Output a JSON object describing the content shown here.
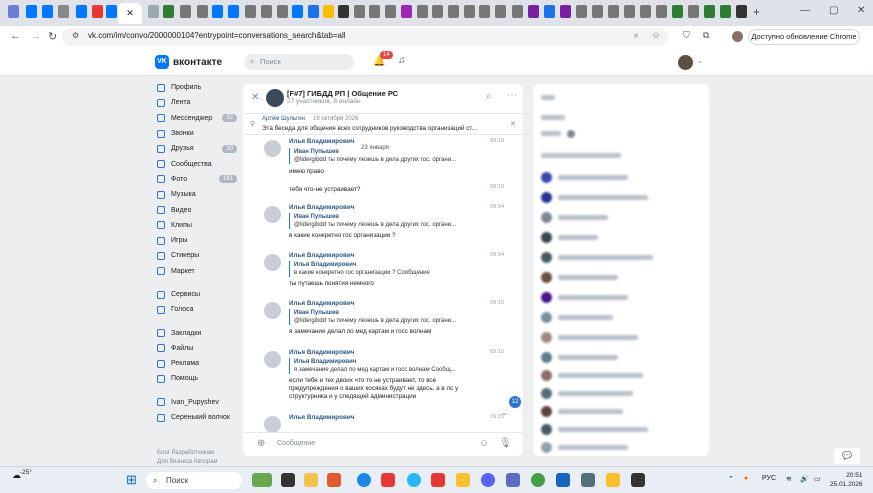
{
  "browser": {
    "url": "vk.com/im/convo/2000000104?entrypoint=conversations_search&tab=all",
    "update_button": "Доступно обновление Chrome",
    "new_tab": "+",
    "minimize": "—",
    "restore": "▢",
    "close": "✕",
    "active_tab_close": "✕"
  },
  "vk": {
    "logo": "вконтакте",
    "search_placeholder": "Поиск",
    "notif_count": "14"
  },
  "menu": [
    {
      "label": "Профиль"
    },
    {
      "label": "Лента"
    },
    {
      "label": "Мессенджер",
      "count": "52"
    },
    {
      "label": "Звонки"
    },
    {
      "label": "Друзья",
      "count": "30"
    },
    {
      "label": "Сообщества"
    },
    {
      "label": "Фото",
      "count": "181"
    },
    {
      "label": "Музыка"
    },
    {
      "label": "Видео"
    },
    {
      "label": "Клипы"
    },
    {
      "label": "Игры"
    },
    {
      "label": "Стикеры"
    },
    {
      "label": "Маркет"
    }
  ],
  "menu2": [
    {
      "label": "Сервисы"
    },
    {
      "label": "Голоса"
    }
  ],
  "menu3": [
    {
      "label": "Закладки"
    },
    {
      "label": "Файлы"
    },
    {
      "label": "Реклама"
    },
    {
      "label": "Помощь"
    }
  ],
  "menu4": [
    {
      "label": "Ivan_Pupyshev"
    },
    {
      "label": "Серенький волчок"
    }
  ],
  "footer": {
    "line1": "Блог   Разработчикам",
    "line2": "Для бизнеса   Авторам"
  },
  "chat": {
    "title": "[F#7] ГИБДД РП | Общение РС",
    "subtitle": "27 участников, 8 онлайн",
    "pinned_author": "Артём Шульгин",
    "pinned_date": "19 октября 2026",
    "pinned_text": "Эта беседа для общения всех сотрудников руководства организаций ст...",
    "date_pill": "23 января",
    "input_placeholder": "Сообщение",
    "unread": "12",
    "messages": [
      {
        "name": "Илья Владимирович",
        "time": "09:10",
        "quote_name": "Иван Пупышев",
        "quote_text": "@lidergibdd ты почему лезешь в дела других гос. органи...",
        "text": "имею право"
      },
      {
        "name": "",
        "time": "09:10",
        "quote_name": "",
        "quote_text": "",
        "text": "тебя что-не устраивает?"
      },
      {
        "name": "Илья Владимирович",
        "time": "09:14",
        "quote_name": "Иван Пупышев",
        "quote_text": "@lidergibdd ты почему лезешь в дела других гос. органи...",
        "text": "в какие конкретно гос организации ?"
      },
      {
        "name": "Илья Владимирович",
        "time": "09:14",
        "quote_name": "Илья Владимирович",
        "quote_text": "в какие конкретно гос организации ? Сообщение",
        "text": "ты путаешь понятия немного"
      },
      {
        "name": "Илья Владимирович",
        "time": "09:15",
        "quote_name": "Иван Пупышев",
        "quote_text": "@lidergibdd ты почему лезешь в дела других гос. органи...",
        "text": "я замечание делал по мед картам и госс волнам"
      },
      {
        "name": "Илья Владимирович",
        "time": "09:15",
        "quote_name": "Илья Владимирович",
        "quote_text": "я замечание делал по мед картам и госс волнам Сообщ...",
        "text": "если тебя и тех двоих что то не устраивает, то все предупреждения о ваших косяках будут не здесь, а в лс у структурника и у следящей администрации"
      },
      {
        "name": "Илья Владимирович",
        "time": "09:15",
        "quote_name": "",
        "quote_text": "",
        "text": ""
      }
    ]
  },
  "taskbar": {
    "weather": "-25°",
    "search": "Поиск",
    "lang": "РУС",
    "time": "20:51",
    "date": "25.01.2026"
  },
  "colors": {
    "accent": "#2a75d3",
    "vk_blue": "#0077ff",
    "badge": "#e64646"
  }
}
